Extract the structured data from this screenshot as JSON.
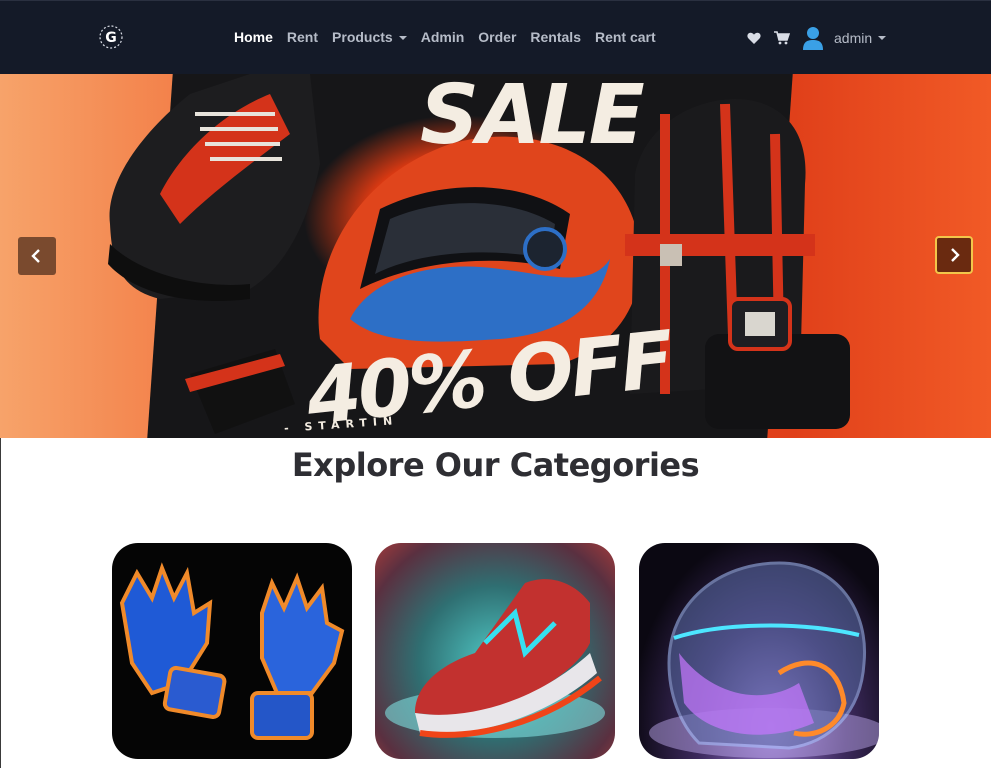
{
  "navbar": {
    "logo_icon": "g-gear-logo-icon",
    "links": [
      {
        "label": "Home",
        "active": true,
        "dropdown": false
      },
      {
        "label": "Rent",
        "active": false,
        "dropdown": false
      },
      {
        "label": "Products",
        "active": false,
        "dropdown": true
      },
      {
        "label": "Admin",
        "active": false,
        "dropdown": false
      },
      {
        "label": "Order",
        "active": false,
        "dropdown": false
      },
      {
        "label": "Rentals",
        "active": false,
        "dropdown": false
      },
      {
        "label": "Rent cart",
        "active": false,
        "dropdown": false
      }
    ],
    "icons": [
      "heart-icon",
      "cart-icon",
      "user-avatar-icon"
    ],
    "user_label": "admin"
  },
  "hero": {
    "headline": "SALE",
    "discount": "40% OFF",
    "tagline": "- STARTIN",
    "prev_icon": "chevron-left-icon",
    "next_icon": "chevron-right-icon"
  },
  "categories": {
    "title": "Explore Our Categories",
    "items": [
      {
        "image": "gloves-image"
      },
      {
        "image": "sneaker-image"
      },
      {
        "image": "helmet-image"
      }
    ]
  },
  "colors": {
    "navbar_bg": "#141a28",
    "accent_orange": "#e0401a",
    "next_button_border": "#f2c64a"
  }
}
